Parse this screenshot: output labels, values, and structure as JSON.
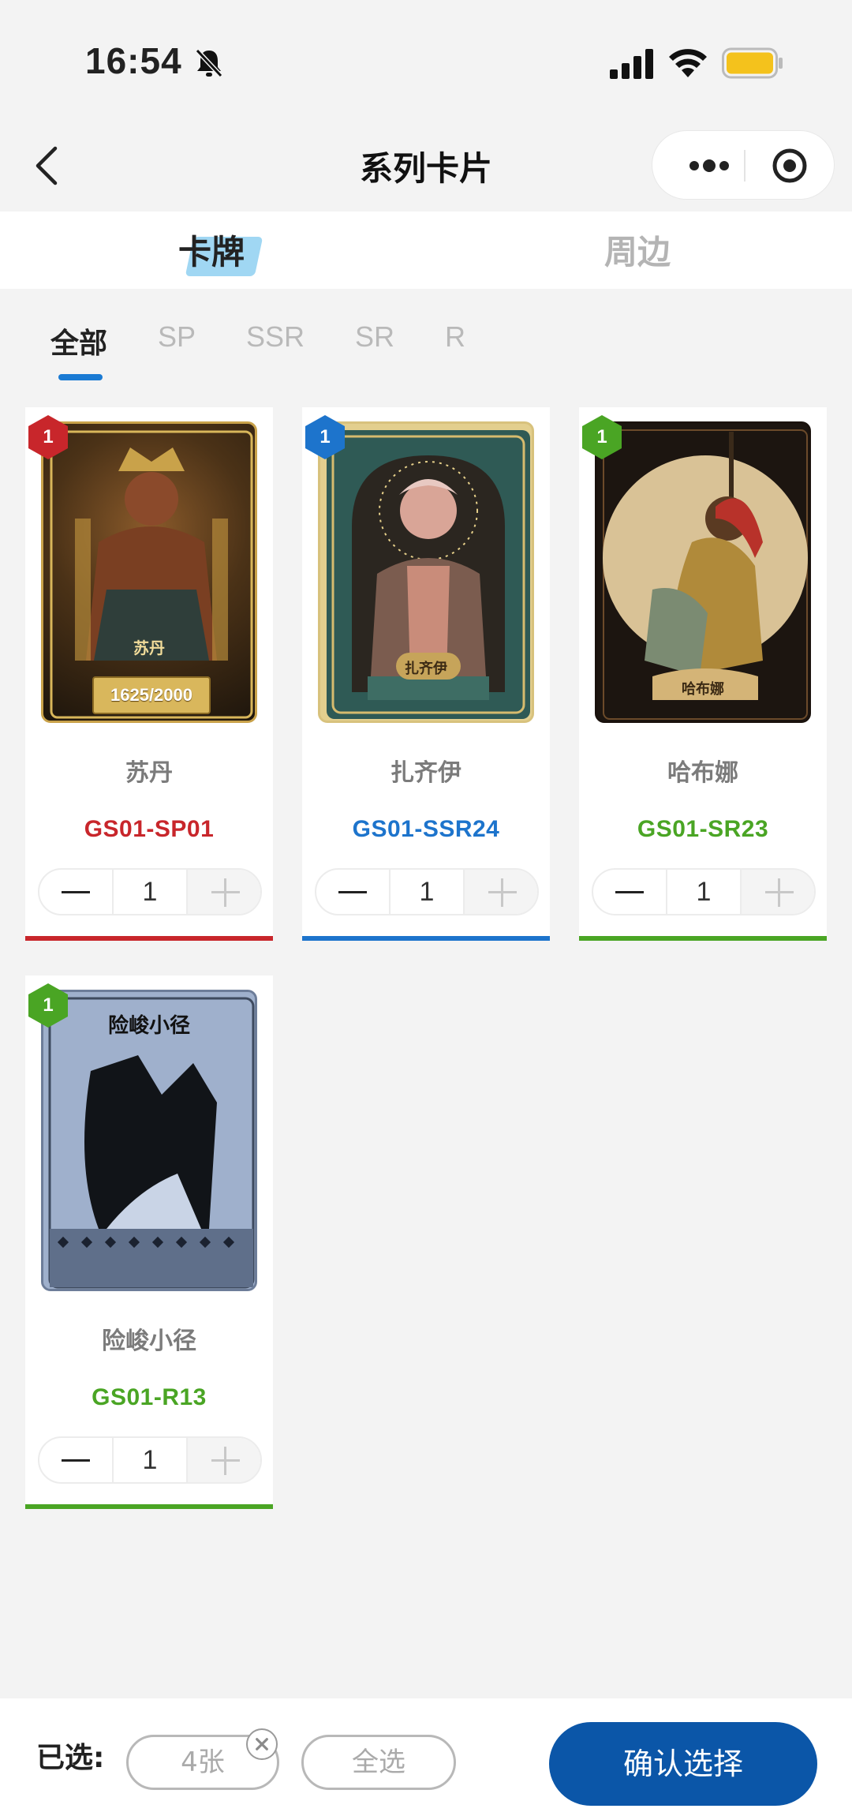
{
  "status_bar": {
    "time": "16:54",
    "icons": [
      "bell-off-icon",
      "signal-icon",
      "wifi-icon",
      "battery-icon"
    ],
    "battery_color": "#f4c21c"
  },
  "nav": {
    "title": "系列卡片",
    "icons": [
      "back-icon",
      "more-icon",
      "target-icon"
    ]
  },
  "top_tabs": [
    {
      "label": "卡牌",
      "active": true
    },
    {
      "label": "周边",
      "active": false
    }
  ],
  "filters": [
    {
      "label": "全部",
      "active": true
    },
    {
      "label": "SP",
      "active": false
    },
    {
      "label": "SSR",
      "active": false
    },
    {
      "label": "SR",
      "active": false
    },
    {
      "label": "R",
      "active": false
    }
  ],
  "cards": [
    {
      "badge": "1",
      "name": "苏丹",
      "code": "GS01-SP01",
      "quantity": "1",
      "color": "#c8262b",
      "art_caption": "苏丹",
      "serial": "1625/2000"
    },
    {
      "badge": "1",
      "name": "扎齐伊",
      "code": "GS01-SSR24",
      "quantity": "1",
      "color": "#1d74cc",
      "art_caption": "扎齐伊"
    },
    {
      "badge": "1",
      "name": "哈布娜",
      "code": "GS01-SR23",
      "quantity": "1",
      "color": "#4aa524",
      "art_caption": "哈布娜"
    },
    {
      "badge": "1",
      "name": "险峻小径",
      "code": "GS01-R13",
      "quantity": "1",
      "color": "#4aa524",
      "art_caption": "险峻小径"
    }
  ],
  "bottom": {
    "selected_label": "已选:",
    "count": "4张",
    "select_all": "全选",
    "confirm": "确认选择",
    "confirm_color": "#0b56a8"
  }
}
